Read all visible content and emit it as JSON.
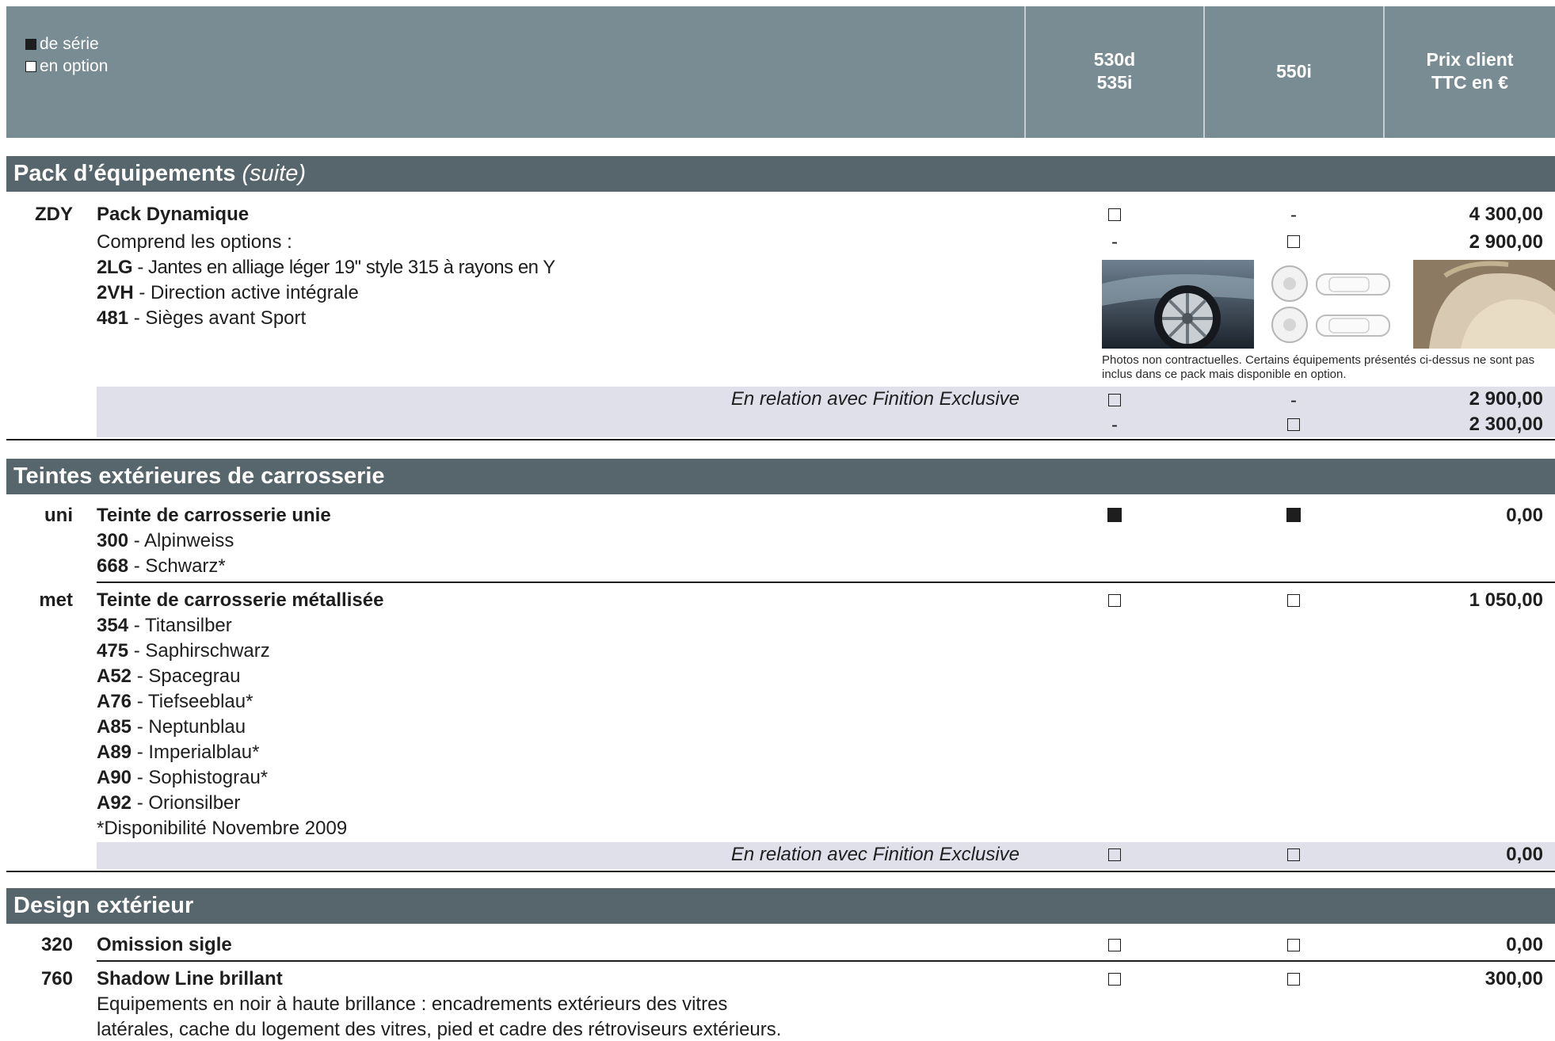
{
  "legend": {
    "standard": "de série",
    "option": "en option"
  },
  "columns": {
    "col1": [
      "530d",
      "535i"
    ],
    "col2": "550i",
    "price": [
      "Prix client",
      "TTC en €"
    ]
  },
  "sections": {
    "pack": {
      "title": "Pack d’équipements",
      "suffix": "(suite)"
    },
    "teintes": {
      "title": "Teintes extérieures de carrosserie"
    },
    "design": {
      "title": "Design extérieur"
    }
  },
  "pack": {
    "code": "ZDY",
    "title": "Pack Dynamique",
    "comprend": "Comprend les options :",
    "items": [
      {
        "code": "2LG",
        "text": " - Jantes en alliage léger 19'' style 315 à rayons en Y"
      },
      {
        "code": "2VH",
        "text": " - Direction active intégrale"
      },
      {
        "code": "481",
        "text": " - Sièges avant Sport"
      }
    ],
    "row1": {
      "c1": "",
      "c2": "-",
      "price": "4 300,00"
    },
    "row2": {
      "c1": "-",
      "c2": "",
      "price": "2 900,00"
    },
    "photo_note": [
      "Photos non contractuelles. Certains équipements présentés ci-dessus ne sont pas",
      "inclus dans ce pack mais disponible en option."
    ],
    "relation": "En relation avec Finition Exclusive",
    "rel_row1": {
      "c2": "-",
      "price": "2 900,00"
    },
    "rel_row2": {
      "c1": "-",
      "price": "2 300,00"
    }
  },
  "uni": {
    "code": "uni",
    "title": "Teinte de carrosserie unie",
    "price": "0,00",
    "items": [
      {
        "code": "300",
        "text": " - Alpinweiss"
      },
      {
        "code": "668",
        "text": " - Schwarz*"
      }
    ]
  },
  "met": {
    "code": "met",
    "title": "Teinte de carrosserie métallisée",
    "price": "1 050,00",
    "items": [
      {
        "code": "354",
        "text": " - Titansilber"
      },
      {
        "code": "475",
        "text": " - Saphirschwarz"
      },
      {
        "code": "A52",
        "text": " - Spacegrau"
      },
      {
        "code": "A76",
        "text": " - Tiefseeblau*"
      },
      {
        "code": "A85",
        "text": " - Neptunblau"
      },
      {
        "code": "A89",
        "text": " - Imperialblau*"
      },
      {
        "code": "A90",
        "text": " - Sophistograu*"
      },
      {
        "code": "A92",
        "text": " - Orionsilber"
      }
    ],
    "note": "*Disponibilité Novembre 2009",
    "relation": "En relation avec Finition Exclusive",
    "rel_price": "0,00"
  },
  "design": {
    "r320": {
      "code": "320",
      "title": "Omission sigle",
      "price": "0,00"
    },
    "r760": {
      "code": "760",
      "title": "Shadow Line brillant",
      "price": "300,00",
      "desc": [
        "Equipements en noir à haute brillance : encadrements extérieurs des vitres",
        "latérales, cache du logement des vitres, pied et cadre des rétroviseurs extérieurs."
      ]
    }
  },
  "colors": {
    "header": "#7a8c93",
    "band": "#57666c",
    "relation_bg": "#dfe0ea"
  }
}
